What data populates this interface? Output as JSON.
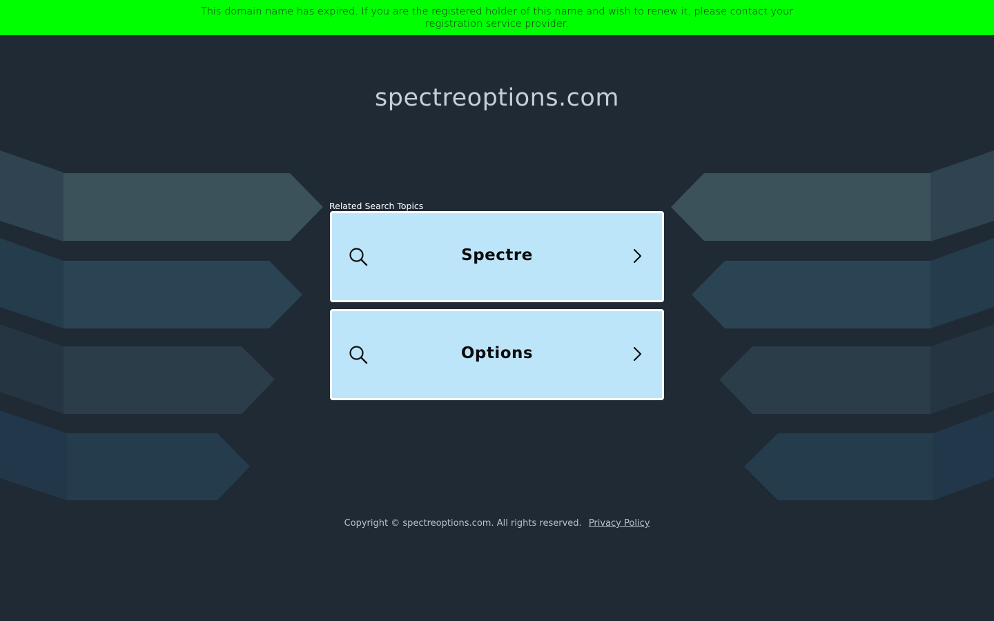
{
  "banner": {
    "text": "This domain name has expired. If you are the registered holder of this name and wish to renew it, please contact your registration service provider."
  },
  "domain": {
    "title": "spectreoptions.com"
  },
  "related": {
    "label": "Related Search Topics",
    "topics": [
      {
        "label": "Spectre"
      },
      {
        "label": "Options"
      }
    ]
  },
  "footer": {
    "copyright": "Copyright © spectreoptions.com.  All rights reserved.",
    "privacy_link": "Privacy Policy"
  },
  "colors": {
    "banner_bg": "#00ff00",
    "page_bg": "#1f2a35",
    "card_bg": "#bde5fa",
    "card_border": "#ffffff"
  },
  "icons": {
    "topic_left": "search-icon",
    "topic_right": "chevron-right-icon"
  }
}
